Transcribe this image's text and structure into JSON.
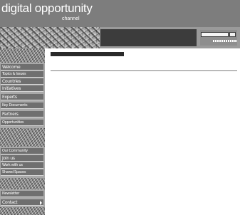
{
  "site": {
    "title": "digital opportunity",
    "subtitle": "channel"
  },
  "search": {
    "placeholder": ""
  },
  "sidebar": {
    "items": [
      {
        "label": "Welcome"
      },
      {
        "label": "Topics & Issues"
      },
      {
        "label": "Countries"
      },
      {
        "label": "Initiatives"
      },
      {
        "label": "Experts"
      },
      {
        "label": "Key Documents"
      },
      {
        "label": "Partners"
      },
      {
        "label": "Opportunities"
      },
      {
        "label": "Our Community"
      },
      {
        "label": "Join us"
      },
      {
        "label": "Work with us"
      },
      {
        "label": "Shared Spaces"
      },
      {
        "label": "Newsletter"
      },
      {
        "label": "Contact"
      }
    ]
  },
  "content": {
    "breadcrumb": "",
    "title": "",
    "paragraphs": [
      "",
      "",
      "",
      ""
    ]
  },
  "colors": {
    "header_bg": "#7d7d7d",
    "banner_dark": "#3c3c3c",
    "nav_item_bg": "#6f6f6f",
    "sidebar_bg": "#a9a9a9"
  }
}
